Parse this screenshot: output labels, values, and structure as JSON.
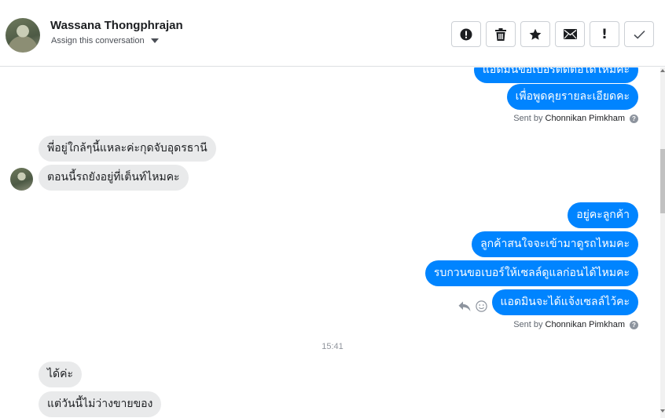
{
  "header": {
    "contact_name": "Wassana Thongphrajan",
    "assign_label": "Assign this conversation",
    "actions": [
      {
        "name": "mark-spam-button",
        "icon": "alert-circle-icon"
      },
      {
        "name": "delete-button",
        "icon": "trash-icon"
      },
      {
        "name": "star-button",
        "icon": "star-icon"
      },
      {
        "name": "mark-unread-button",
        "icon": "envelope-icon"
      },
      {
        "name": "follow-up-button",
        "icon": "exclamation-icon",
        "glyph": "!"
      },
      {
        "name": "mark-done-button",
        "icon": "check-icon"
      }
    ]
  },
  "messages": {
    "out_1": "แอดมินขอเบอร์ติดต่อได้ไหมคะ",
    "out_2": "เพื่อพูดคุยรายละเอียดคะ",
    "sent_by_1": {
      "prefix": "Sent by",
      "name": "Chonnikan Pimkham"
    },
    "in_1": "พี่อยู่ใกล้ๆนี้แหละค่ะกุดจับอุดรธานี",
    "in_2": "ตอนนี้รถยังอยู่ที่เต็นท์ไหมคะ",
    "out_3": "อยู่คะลูกค้า",
    "out_4": "ลูกค้าสนใจจะเข้ามาดูรถไหมคะ",
    "out_5": "รบกวนขอเบอร์ให้เซลล์ดูแลก่อนได้ไหมคะ",
    "out_6": "แอดมินจะได้แจ้งเซลล์ไว้คะ",
    "sent_by_2": {
      "prefix": "Sent by",
      "name": "Chonnikan Pimkham"
    },
    "timestamp": "15:41",
    "in_3": "ได้ค่ะ",
    "in_4": "แต่วันนี้ไม่ว่างขายของ"
  },
  "colors": {
    "accent": "#0084ff",
    "incoming_bubble": "#e9eaeb",
    "border": "#ccd0d5"
  }
}
